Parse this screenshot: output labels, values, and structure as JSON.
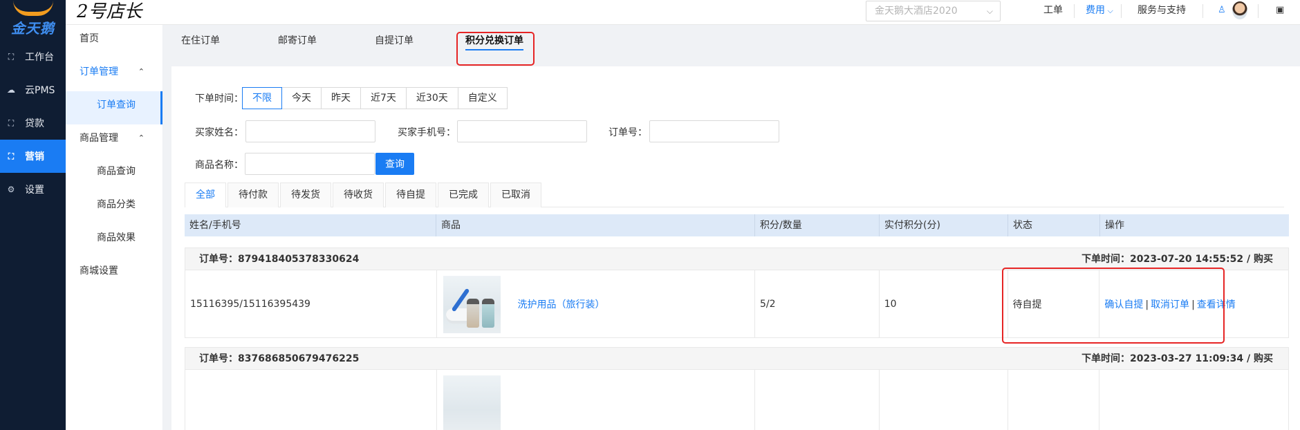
{
  "brand": {
    "logo_text": "金天鹅",
    "product_name": "2号店长"
  },
  "rail": [
    {
      "icon": "workbench-icon",
      "glyph": "⛶",
      "label": "工作台"
    },
    {
      "icon": "cloud-icon",
      "glyph": "☁",
      "label": "云PMS"
    },
    {
      "icon": "loan-icon",
      "glyph": "⛶",
      "label": "贷款"
    },
    {
      "icon": "marketing-icon",
      "glyph": "⛶",
      "label": "营销",
      "active": true
    },
    {
      "icon": "settings-icon",
      "glyph": "⚙",
      "label": "设置"
    }
  ],
  "topbar": {
    "hotel_select": "金天鹅大酒店2020",
    "work_order": "工单",
    "fee": "费用",
    "service": "服务与支持"
  },
  "subnav": {
    "home": "首页",
    "order_mgmt": "订单管理",
    "order_query": "订单查询",
    "goods_mgmt": "商品管理",
    "goods_query": "商品查询",
    "goods_category": "商品分类",
    "goods_effect": "商品效果",
    "mall_settings": "商城设置"
  },
  "order_types": [
    "在住订单",
    "邮寄订单",
    "自提订单",
    "积分兑换订单"
  ],
  "active_order_type": "积分兑换订单",
  "filters": {
    "order_time_label": "下单时间：",
    "time_options": [
      "不限",
      "今天",
      "昨天",
      "近7天",
      "近30天",
      "自定义"
    ],
    "selected_time": "不限",
    "buyer_name_label": "买家姓名：",
    "buyer_phone_label": "买家手机号：",
    "order_no_label": "订单号：",
    "goods_name_label": "商品名称：",
    "buyer_name_value": "",
    "buyer_phone_value": "",
    "order_no_value": "",
    "goods_name_value": "",
    "query_button": "查询"
  },
  "status_tabs": [
    "全部",
    "待付款",
    "待发货",
    "待收货",
    "待自提",
    "已完成",
    "已取消"
  ],
  "active_status": "全部",
  "table": {
    "columns": [
      "姓名/手机号",
      "商品",
      "积分/数量",
      "实付积分(分)",
      "状态",
      "操作"
    ]
  },
  "orders": [
    {
      "order_no": "订单号：879418405378330624",
      "order_time": "下单时间：2023-07-20 14:55:52 / 购买",
      "buyer": "15116395/15116395439",
      "goods_name": "洗护用品（旅行装）",
      "points_qty": "5/2",
      "paid_points": "10",
      "status": "待自提",
      "actions": [
        "确认自提",
        "取消订单",
        "查看详情"
      ]
    },
    {
      "order_no": "订单号：837686850679476225",
      "order_time": "下单时间：2023-03-27 11:09:34 / 购买"
    }
  ]
}
